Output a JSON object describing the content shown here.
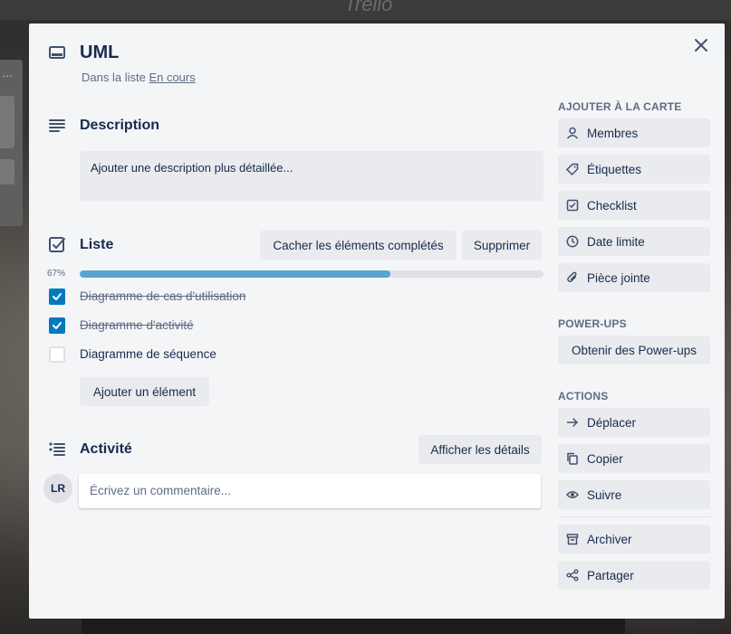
{
  "background": {
    "logo_text": "Trello",
    "list_menu": "..."
  },
  "card": {
    "title": "UML",
    "list_prefix": "Dans la liste",
    "list_name": "En cours"
  },
  "description": {
    "heading": "Description",
    "placeholder": "Ajouter une description plus détaillée..."
  },
  "checklist": {
    "heading": "Liste",
    "hide_completed_label": "Cacher les éléments complétés",
    "delete_label": "Supprimer",
    "progress_text": "67%",
    "progress_fraction": 0.67,
    "items": [
      {
        "label": "Diagramme de cas d'utilisation",
        "checked": true
      },
      {
        "label": "Diagramme d'activité",
        "checked": true
      },
      {
        "label": "Diagramme de séquence",
        "checked": false
      }
    ],
    "add_item_label": "Ajouter un élément"
  },
  "activity": {
    "heading": "Activité",
    "show_details_label": "Afficher les détails",
    "avatar_initials": "LR",
    "comment_placeholder": "Écrivez un commentaire..."
  },
  "sidebar": {
    "add_to_card_heading": "AJOUTER À LA CARTE",
    "add_to_card": [
      {
        "label": "Membres",
        "icon": "user-icon"
      },
      {
        "label": "Étiquettes",
        "icon": "tag-icon"
      },
      {
        "label": "Checklist",
        "icon": "checkbox-icon"
      },
      {
        "label": "Date limite",
        "icon": "clock-icon"
      },
      {
        "label": "Pièce jointe",
        "icon": "paperclip-icon"
      }
    ],
    "powerups_heading": "POWER-UPS",
    "powerups_button": "Obtenir des Power-ups",
    "actions_heading": "ACTIONS",
    "actions": [
      {
        "label": "Déplacer",
        "icon": "arrow-right-icon"
      },
      {
        "label": "Copier",
        "icon": "copy-icon"
      },
      {
        "label": "Suivre",
        "icon": "eye-icon"
      },
      {
        "label": "Archiver",
        "icon": "archive-icon"
      },
      {
        "label": "Partager",
        "icon": "share-icon"
      }
    ]
  },
  "colors": {
    "accent": "#0079bf",
    "progress": "#5ba4cf",
    "text": "#172b4d",
    "muted": "#5e6c84",
    "modal_bg": "#f4f5f7",
    "button_bg": "#e9ebee"
  }
}
